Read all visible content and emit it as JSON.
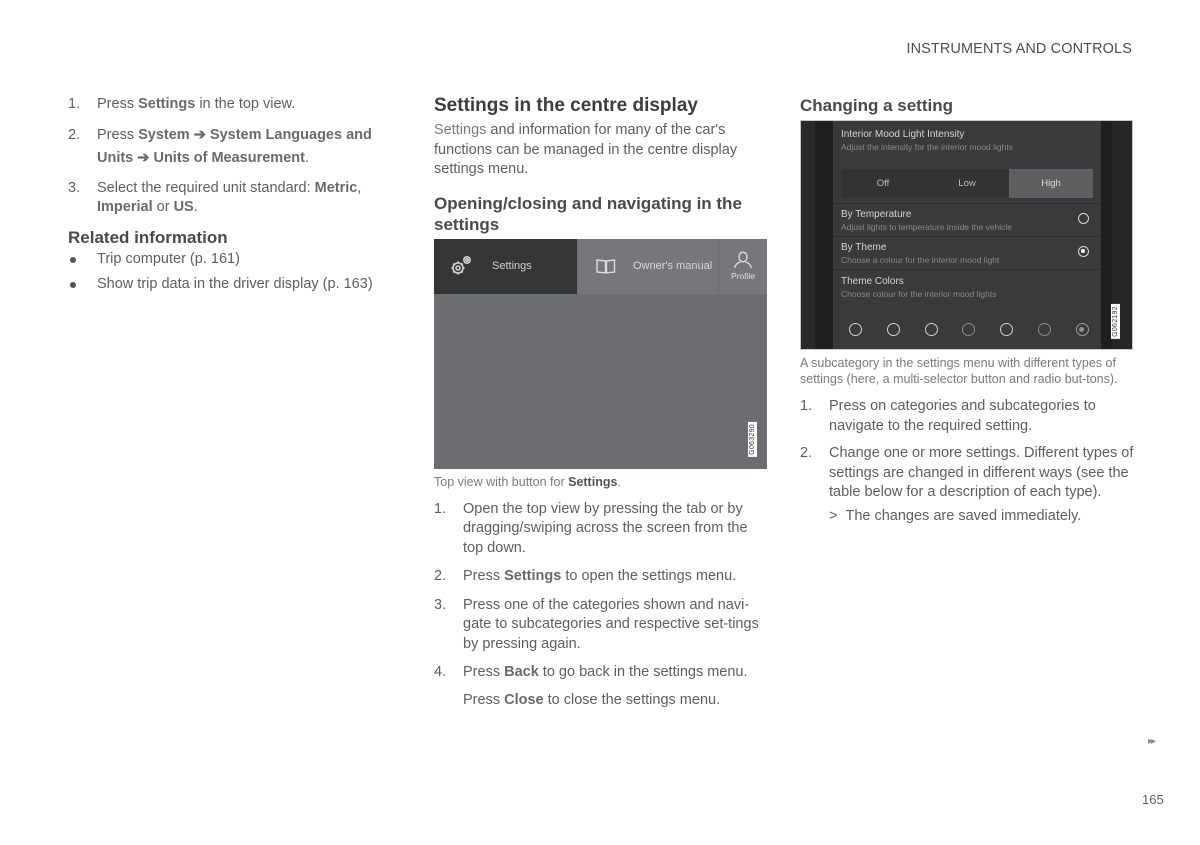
{
  "header": {
    "section_title": "INSTRUMENTS AND CONTROLS"
  },
  "left_column": {
    "steps": [
      {
        "num": "1.",
        "parts": [
          "Press ",
          "Settings",
          " in the top view."
        ]
      },
      {
        "num": "2.",
        "parts": [
          "Press ",
          "System",
          " ➔ ",
          "System Languages and Units",
          " ➔ ",
          "Units of Measurement",
          "."
        ]
      },
      {
        "num": "3.",
        "parts": [
          "Select the required unit standard: ",
          "Metric",
          ", ",
          "Imperial",
          " or ",
          "US",
          "."
        ]
      }
    ],
    "related_heading": "Related information",
    "related_links": [
      "Trip computer (p. 161)",
      "Show trip data in the driver display (p. 163)"
    ]
  },
  "middle_column": {
    "title": "Settings in the centre display",
    "intro_highlight": "Settings",
    "intro_rest": " and information for many of the car's functions can be managed in the centre display settings menu.",
    "section_heading": "Opening/closing and navigating in the settings",
    "screenshot": {
      "tabs": {
        "settings": "Settings",
        "manual": "Owner's manual",
        "profile": "Profile"
      },
      "icons": {
        "settings": "gear-icon",
        "manual": "book-icon",
        "profile": "person-icon"
      },
      "image_id": "G063290"
    },
    "caption_pre": "Top view with button for ",
    "caption_bold": "Settings",
    "caption_post": ".",
    "steps": [
      {
        "num": "1.",
        "pre": "Open the top view by pressing the tab or by dragging/swiping across the screen from the top down.",
        "bold": "",
        "post": ""
      },
      {
        "num": "2.",
        "pre": "Press ",
        "bold": "Settings",
        "post": " to open the settings menu."
      },
      {
        "num": "3.",
        "pre": "Press one of the categories shown and navi-gate to subcategories and respective set-tings by pressing again.",
        "bold": "",
        "post": ""
      },
      {
        "num": "4.",
        "pre": "Press ",
        "bold": "Back",
        "post": " to go back in the settings menu."
      }
    ],
    "close_note": {
      "pre": "Press ",
      "bold": "Close",
      "post": " to close the settings menu."
    }
  },
  "right_column": {
    "title": "Changing a setting",
    "screenshot": {
      "intensity_title": "Interior Mood Light Intensity",
      "intensity_sub": "Adjust the intensity for the interior mood lights",
      "segments": [
        "Off",
        "Low",
        "High"
      ],
      "selected_segment": "High",
      "options": [
        {
          "title": "By Temperature",
          "sub": "Adjust lights to temperature inside the vehicle",
          "selected": false
        },
        {
          "title": "By Theme",
          "sub": "Choose a colour for the interior mood light",
          "selected": true
        }
      ],
      "theme_title": "Theme Colors",
      "theme_sub": "Choose colour for the interior mood lights",
      "color_choices": 7,
      "selected_color_index": 6,
      "image_id": "G062192"
    },
    "caption": "A subcategory in the settings menu with different types of settings (here, a multi-selector button and radio but-tons).",
    "steps": [
      {
        "num": "1.",
        "text": "Press on categories and subcategories to navigate to the required setting."
      },
      {
        "num": "2.",
        "text": "Change one or more settings. Different types of settings are changed in different ways (see the table below for a description of each type)."
      }
    ],
    "result_marker": ">",
    "result": "The changes are saved immediately."
  },
  "footer": {
    "continue_marker": "▸▸",
    "page_number": "165"
  }
}
